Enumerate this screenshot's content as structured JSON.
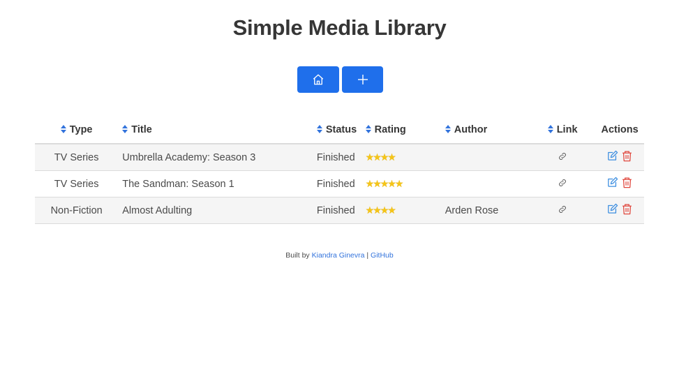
{
  "header": {
    "title": "Simple Media Library"
  },
  "toolbar": {
    "home_icon": "home-icon",
    "add_icon": "plus-icon"
  },
  "table": {
    "columns": {
      "type": "Type",
      "title": "Title",
      "status": "Status",
      "rating": "Rating",
      "author": "Author",
      "link": "Link",
      "actions": "Actions"
    },
    "rows": [
      {
        "type": "TV Series",
        "title": "Umbrella Academy: Season 3",
        "status": "Finished",
        "rating": 4,
        "author": ""
      },
      {
        "type": "TV Series",
        "title": "The Sandman: Season 1",
        "status": "Finished",
        "rating": 5,
        "author": ""
      },
      {
        "type": "Non-Fiction",
        "title": "Almost Adulting",
        "status": "Finished",
        "rating": 4,
        "author": "Arden Rose"
      }
    ]
  },
  "footer": {
    "prefix": "Built by ",
    "author_link": "Kiandra Ginevra",
    "separator": " | ",
    "github_link": "GitHub"
  },
  "colors": {
    "primary": "#1f6feb",
    "edit": "#3b8de0",
    "delete": "#e0473d",
    "star": "#f5c518"
  }
}
